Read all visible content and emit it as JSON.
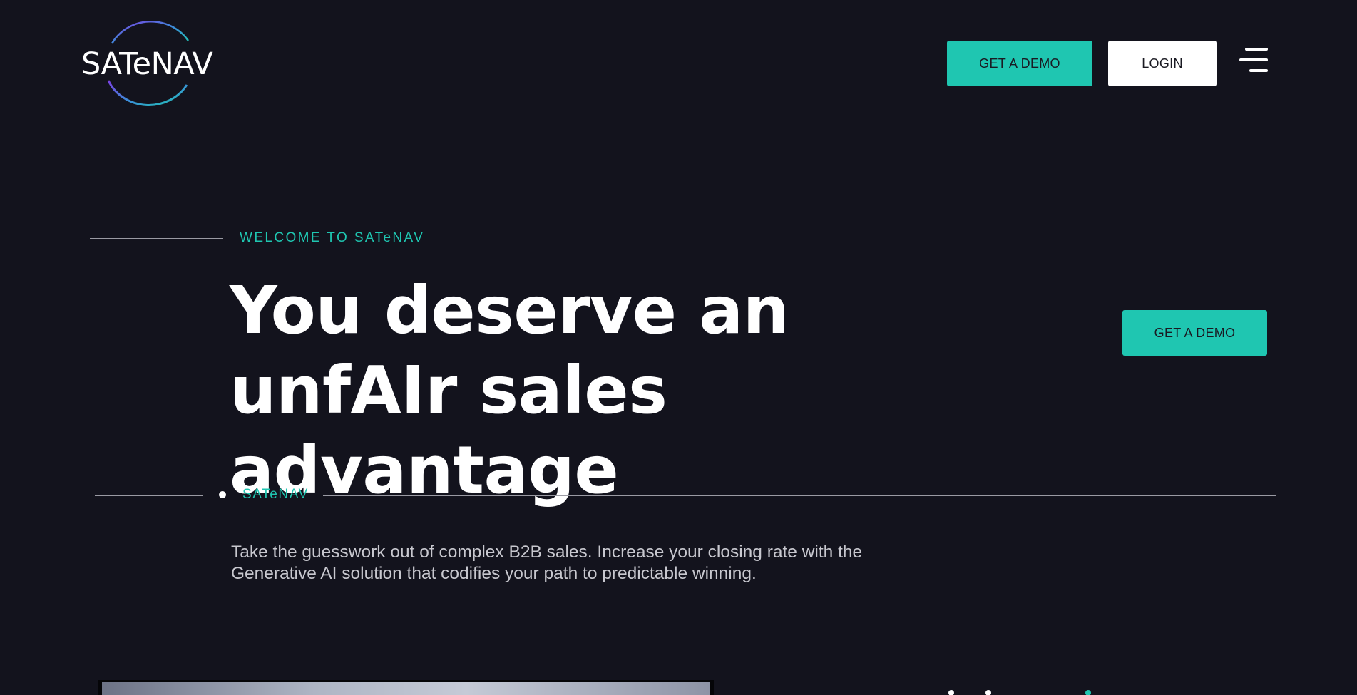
{
  "header": {
    "logo_text": "SATeNAV",
    "demo_button": "GET A DEMO",
    "login_button": "LOGIN",
    "menu_icon": "hamburger-menu-icon"
  },
  "hero": {
    "eyebrow": "WELCOME TO SATeNAV",
    "title": "You deserve an unfAIr sales advantage",
    "demo_button": "GET A DEMO"
  },
  "divider": {
    "label": "SATeNAV"
  },
  "intro": {
    "description": "Take the guesswork out of complex B2B sales. Increase your closing rate with the Generative AI solution that codifies your path to predictable winning."
  },
  "colors": {
    "background": "#13131d",
    "accent": "#1fc6b1",
    "text": "#ffffff",
    "muted_text": "#c8c8cf",
    "logo_ring_start": "#7b3fe4",
    "logo_ring_end": "#1fc6b1"
  }
}
